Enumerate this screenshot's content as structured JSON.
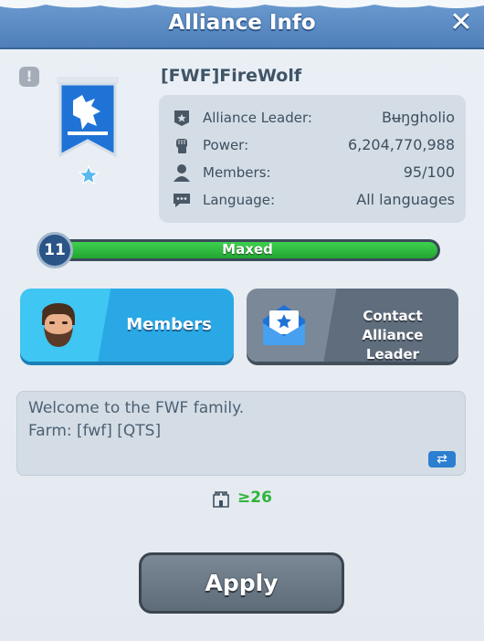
{
  "header": {
    "title": "Alliance Info",
    "close_glyph": "✕"
  },
  "alliance": {
    "name": "[FWF]FireWolf",
    "alert_glyph": "!",
    "stats": [
      {
        "icon": "crest-icon",
        "label": "Alliance Leader:",
        "value": "Bʉŋgholio"
      },
      {
        "icon": "fist-icon",
        "label": "Power:",
        "value": "6,204,770,988"
      },
      {
        "icon": "person-icon",
        "label": "Members:",
        "value": "95/100"
      },
      {
        "icon": "chat-icon",
        "label": "Language:",
        "value": "All languages"
      }
    ]
  },
  "level": {
    "number": "11",
    "status": "Maxed",
    "progress_fraction": 1.0
  },
  "buttons": {
    "members": "Members",
    "contact_line1": "Contact Alliance",
    "contact_line2": "Leader",
    "apply": "Apply"
  },
  "description": {
    "line1": "Welcome to the FWF family.",
    "line2": "Farm: [fwf] [QTS]",
    "translate_glyph": "⇄"
  },
  "requirement": {
    "value": "≥26"
  },
  "colors": {
    "header": "#5b8bc6",
    "progress_green": "#2fbf3f",
    "members_blue": "#2fb2ec",
    "contact_gray": "#6c7a89"
  }
}
